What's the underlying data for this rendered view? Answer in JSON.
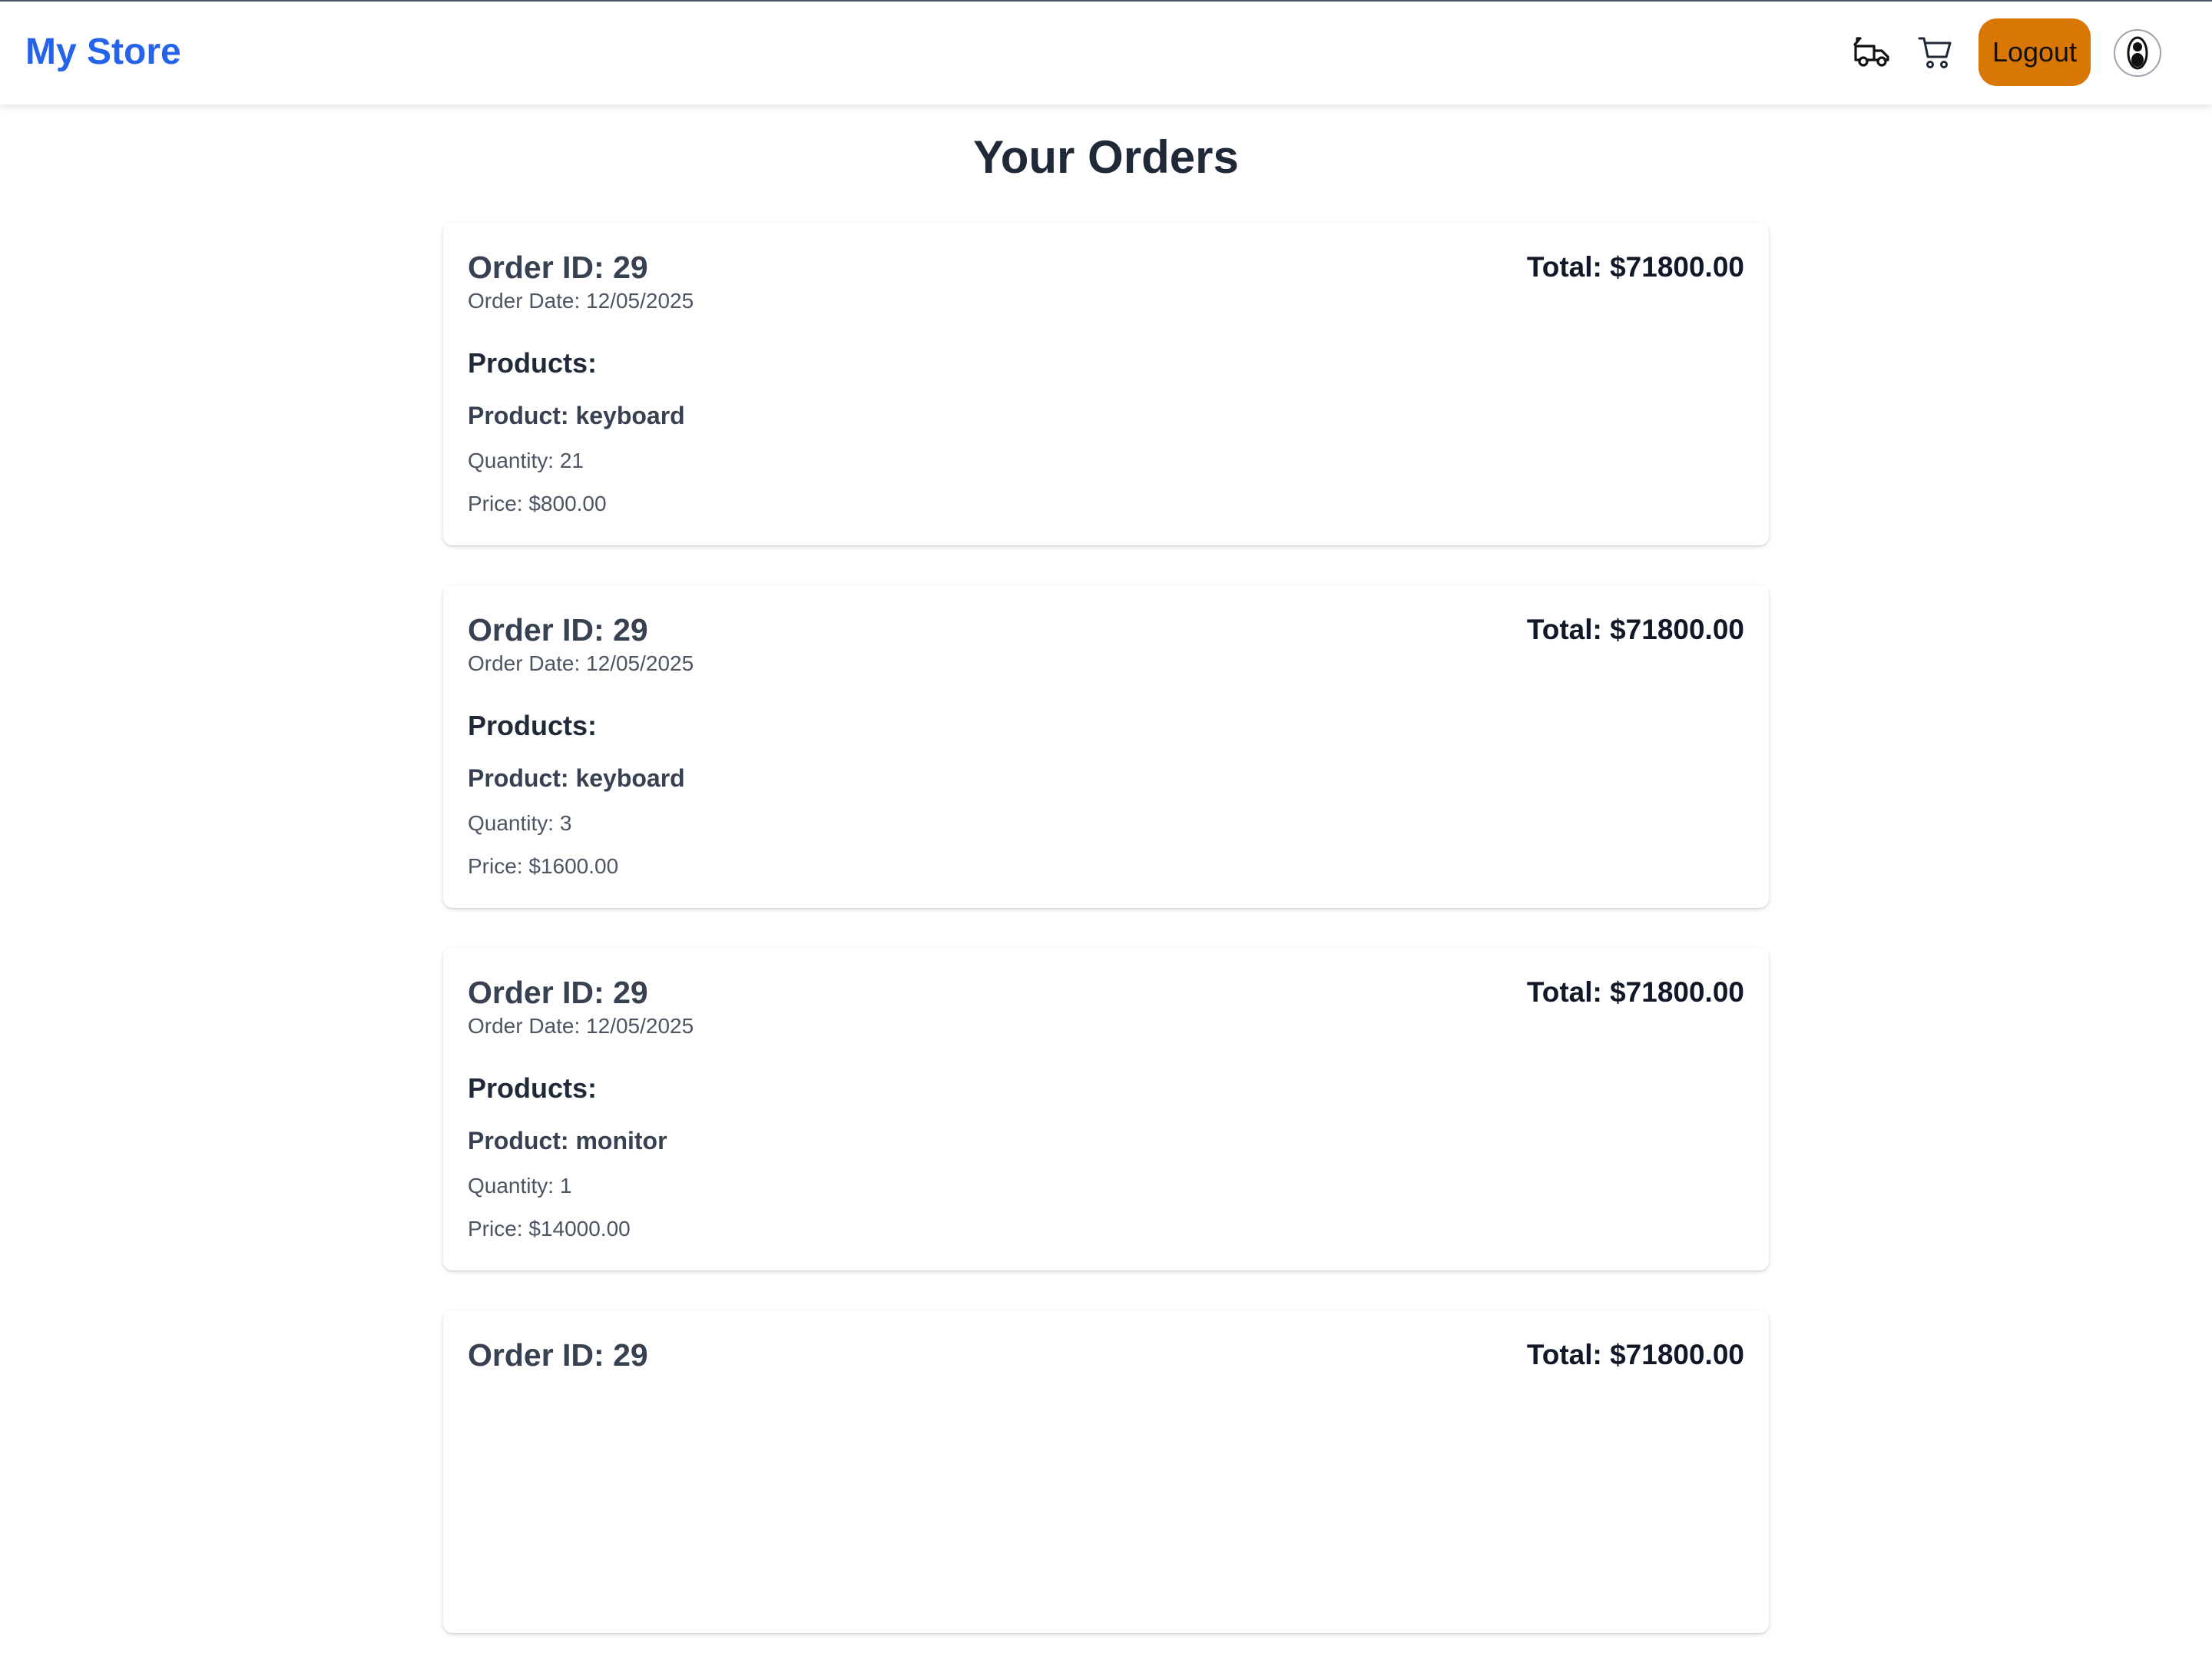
{
  "navbar": {
    "brand": "My Store",
    "logout_label": "Logout",
    "icons": [
      "delivery-truck-icon",
      "cart-icon",
      "avatar-icon"
    ],
    "brand_color": "#2563eb",
    "logout_color": "#d97706"
  },
  "page": {
    "title": "Your Orders"
  },
  "orders": [
    {
      "order_id": "Order ID: 29",
      "order_date": "Order Date: 12/05/2025",
      "total": "Total: $71800.00",
      "products_heading": "Products:",
      "product": "Product: keyboard",
      "quantity": "Quantity: 21",
      "price": "Price: $800.00"
    },
    {
      "order_id": "Order ID: 29",
      "order_date": "Order Date: 12/05/2025",
      "total": "Total: $71800.00",
      "products_heading": "Products:",
      "product": "Product: keyboard",
      "quantity": "Quantity: 3",
      "price": "Price: $1600.00"
    },
    {
      "order_id": "Order ID: 29",
      "order_date": "Order Date: 12/05/2025",
      "total": "Total: $71800.00",
      "products_heading": "Products:",
      "product": "Product: monitor",
      "quantity": "Quantity: 1",
      "price": "Price: $14000.00"
    },
    {
      "order_id": "Order ID: 29",
      "order_date": "",
      "total": "Total: $71800.00",
      "products_heading": "",
      "product": "",
      "quantity": "",
      "price": ""
    }
  ]
}
